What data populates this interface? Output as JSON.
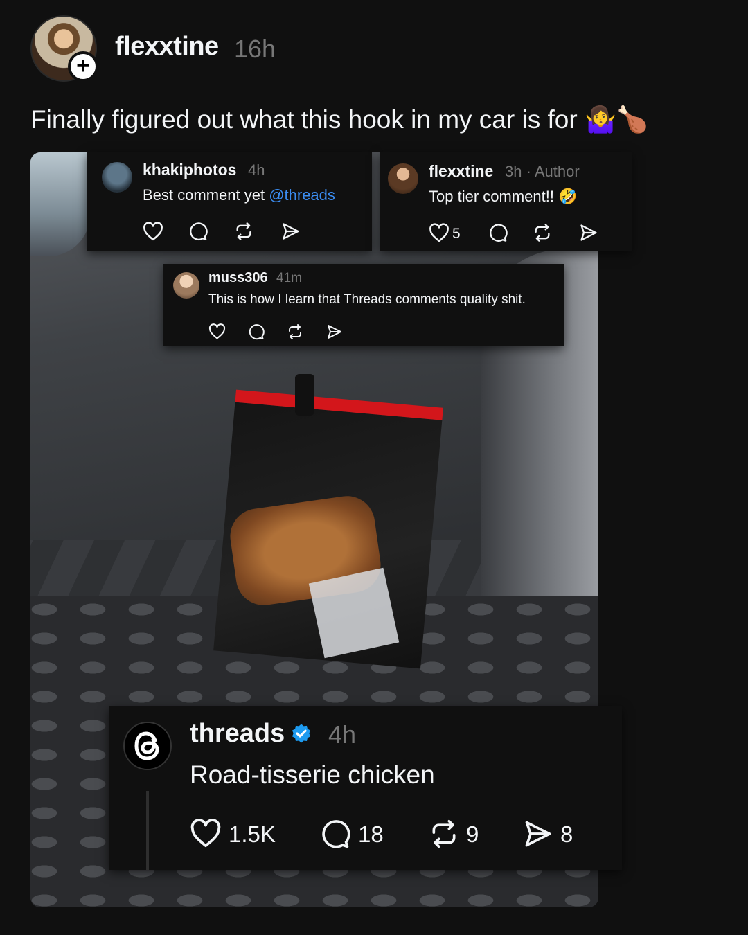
{
  "post": {
    "author": "flexxtine",
    "time": "16h",
    "caption": "Finally figured out what this hook in my car is for 🤷‍♀️🍗",
    "avatar_icon": "user-avatar",
    "follow_icon": "plus-icon"
  },
  "comments": [
    {
      "author": "khakiphotos",
      "time": "4h",
      "text_before": "Best comment yet ",
      "mention": "@threads",
      "likes": ""
    },
    {
      "author": "flexxtine",
      "time": "3h",
      "tag": " · Author",
      "text": "Top tier comment!! 🤣",
      "likes": "5"
    },
    {
      "author": "muss306",
      "time": "41m",
      "text": "This is how I learn that Threads comments quality shit."
    },
    {
      "author": "threads",
      "verified": true,
      "time": "4h",
      "text": "Road-tisserie chicken",
      "likes": "1.5K",
      "replies": "18",
      "reposts": "9",
      "shares": "8"
    }
  ],
  "colors": {
    "background": "#101010",
    "text": "#f3f5f7",
    "muted": "#777777",
    "mention": "#3b8cf0",
    "verified": "#1d9bf0"
  },
  "icons": [
    "heart-icon",
    "comment-icon",
    "repost-icon",
    "share-icon",
    "verified-badge-icon",
    "threads-logo-icon"
  ]
}
